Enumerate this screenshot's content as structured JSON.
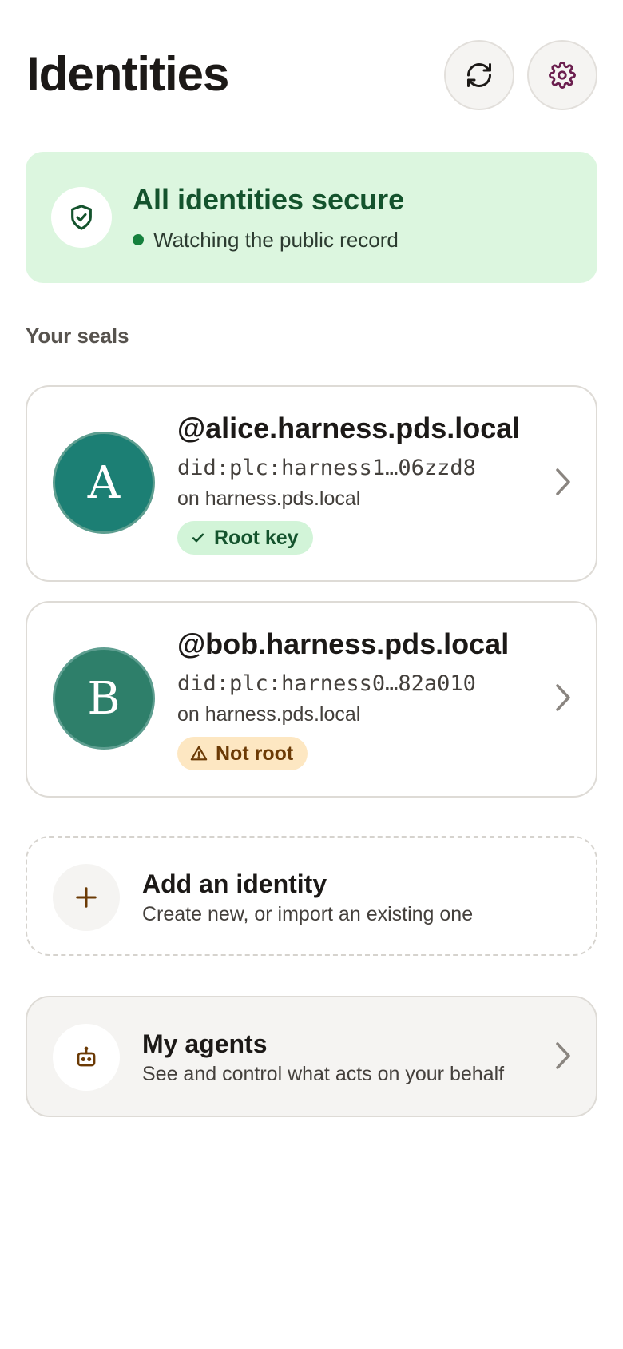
{
  "header": {
    "title": "Identities",
    "refresh_icon": "refresh-icon",
    "settings_icon": "gear-icon"
  },
  "status": {
    "title": "All identities secure",
    "subtitle": "Watching the public record",
    "icon": "shield-check-icon",
    "color": "#15803d"
  },
  "seals": {
    "label": "Your seals",
    "items": [
      {
        "initial": "A",
        "handle": "@alice.harness.pds.local",
        "did": "did:plc:harness1…06zzd8",
        "host": "on harness.pds.local",
        "badge": "Root key",
        "badge_icon": "check-icon",
        "avatar_color": "#1c7f74"
      },
      {
        "initial": "B",
        "handle": "@bob.harness.pds.local",
        "did": "did:plc:harness0…82a010",
        "host": "on harness.pds.local",
        "badge": "Not root",
        "badge_icon": "warning-icon",
        "avatar_color": "#2e7f6a"
      }
    ]
  },
  "add_identity": {
    "title": "Add an identity",
    "subtitle": "Create new, or import an existing one",
    "icon": "plus-icon"
  },
  "agents": {
    "title": "My agents",
    "subtitle": "See and control what acts on your behalf",
    "icon": "robot-icon"
  }
}
